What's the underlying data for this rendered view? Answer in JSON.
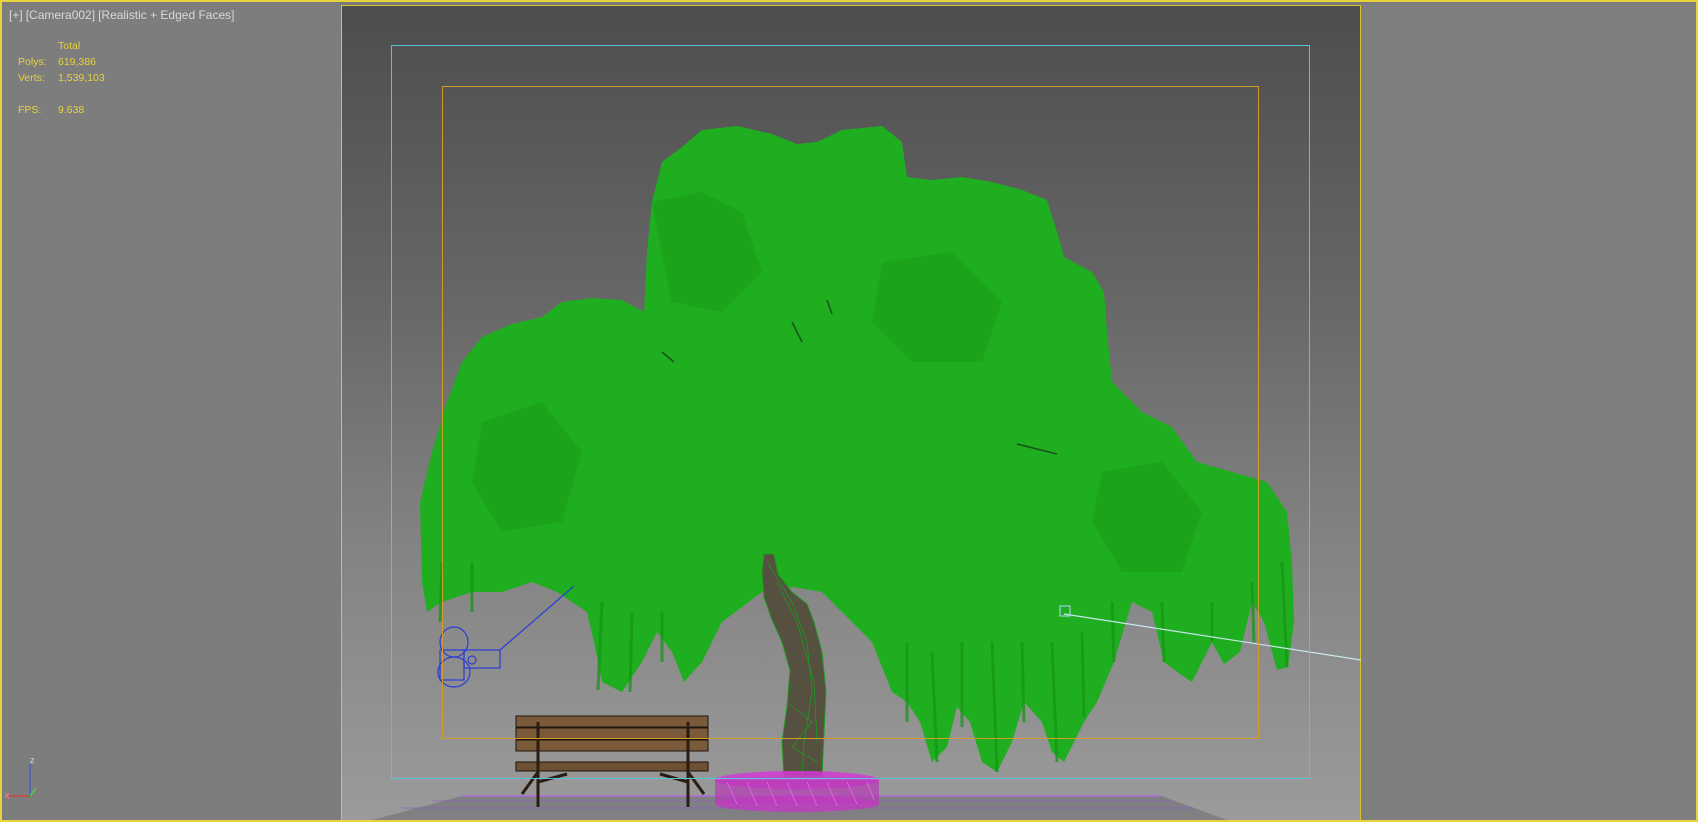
{
  "viewport": {
    "menu": "[+]",
    "camera": "[Camera002]",
    "shading": "[Realistic + Edged Faces]"
  },
  "stats": {
    "header": "Total",
    "polys_label": "Polys:",
    "polys_value": "619,386",
    "verts_label": "Verts:",
    "verts_value": "1,539,103",
    "fps_label": "FPS:",
    "fps_value": "9.638"
  },
  "axis_gizmo": {
    "x": "x",
    "z": "z"
  },
  "colors": {
    "viewport_border": "#e6d43a",
    "stats_text": "#e8d23a",
    "foliage": "#1fae1f",
    "safe_frame_outer": "#55c4d6",
    "safe_frame_inner": "#d39b2a",
    "planter": "#d23ad2",
    "camera_helper": "#2a3cd6"
  },
  "scene_objects": {
    "tree": "willow-tree",
    "bench": "park-bench",
    "planter": "planter-ring",
    "camera": "camera-helper"
  }
}
